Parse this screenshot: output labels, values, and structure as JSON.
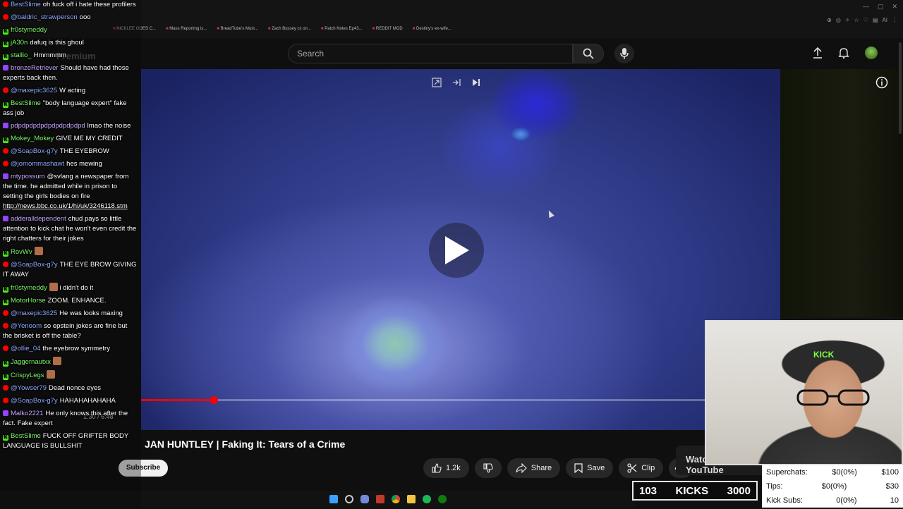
{
  "browser": {
    "bookmarks": [
      "NICKLEE GOES C...",
      "Mass Reporting is...",
      "BreadTube's Most...",
      "Zach Bussey cx on...",
      "Patch Notes Ep43...",
      "REDDIT MOD",
      "Destiny's ex-wife..."
    ]
  },
  "header": {
    "logo_text": "Premium",
    "search_placeholder": "Search"
  },
  "video": {
    "title": "JAN HUNTLEY | Faking It: Tears of a Crime",
    "time": "1:30 / 6:48",
    "progress_fraction": 0.13
  },
  "channel": {
    "subscribe_label": "Subscribe"
  },
  "actions": {
    "like_count": "1.2k",
    "share_label": "Share",
    "save_label": "Save",
    "clip_label": "Clip"
  },
  "watch_on": "Watch on YouTube",
  "chat": {
    "messages": [
      {
        "platform": "yt",
        "user": "BestSlime",
        "text": "oh fuck off i hate these profilers",
        "color": "u-blue"
      },
      {
        "platform": "yt",
        "user": "@baldric_strawperson",
        "text": "ooo",
        "color": "u-blue"
      },
      {
        "platform": "kick",
        "user": "fr0stymeddy",
        "text": "",
        "color": "u-green"
      },
      {
        "platform": "kick",
        "user": "jA30n",
        "text": "dafuq is this ghoul",
        "color": "u-green"
      },
      {
        "platform": "kick",
        "user": "stallio_",
        "text": "Hmmmmm",
        "color": "u-green"
      },
      {
        "platform": "twitch",
        "user": "bronzeRetriever",
        "text": "Should have had those experts back then.",
        "color": "u-purple"
      },
      {
        "platform": "yt",
        "user": "@maxepic3625",
        "text": "W acting",
        "color": "u-blue"
      },
      {
        "platform": "kick",
        "user": "BestSlime",
        "text": "\"body language expert\" fake ass job",
        "color": "u-green"
      },
      {
        "platform": "twitch",
        "user": "pdpdpdpdpdpdpdpdpdpd",
        "text": "lmao the noise",
        "color": "u-purple"
      },
      {
        "platform": "kick",
        "user": "Mokey_Mokey",
        "text": "GIVE ME MY CREDIT",
        "color": "u-green"
      },
      {
        "platform": "yt",
        "user": "@SoapBox-g7y",
        "text": "THE EYEBROW",
        "color": "u-blue"
      },
      {
        "platform": "yt",
        "user": "@jomommashawt",
        "text": "hes mewing",
        "color": "u-blue"
      },
      {
        "platform": "twitch",
        "user": "mtypossum",
        "text": "@svlang a newspaper from the time. he admitted while in prison to setting the girls bodies on fire",
        "link": "http://news.bbc.co.uk/1/hi/uk/3246118.stm",
        "color": "u-purple"
      },
      {
        "platform": "twitch",
        "user": "adderalldependent",
        "text": "chud pays so little attention to kick chat he won't even credit the right chatters for their jokes",
        "color": "u-purple"
      },
      {
        "platform": "kick",
        "user": "RovWv",
        "text": "",
        "emote": true,
        "color": "u-green"
      },
      {
        "platform": "yt",
        "user": "@SoapBox-g7y",
        "text": "THE EYE BROW GIVING IT AWAY",
        "color": "u-blue"
      },
      {
        "platform": "kick",
        "user": "fr0stymeddy",
        "text": "i didn't do it",
        "emote": true,
        "color": "u-green"
      },
      {
        "platform": "kick",
        "user": "MotorHorse",
        "text": "ZOOM. ENHANCE.",
        "color": "u-green"
      },
      {
        "platform": "yt",
        "user": "@maxepic3625",
        "text": "He was looks maxing",
        "color": "u-blue"
      },
      {
        "platform": "yt",
        "user": "@Yenoom",
        "text": "so epstein jokes are fine but the brisket is off the table?",
        "color": "u-blue"
      },
      {
        "platform": "yt",
        "user": "@ollie_04",
        "text": "the eyebrow symmetry",
        "color": "u-blue"
      },
      {
        "platform": "kick",
        "user": "Jaggernautxx",
        "text": "",
        "emote": true,
        "color": "u-green"
      },
      {
        "platform": "kick",
        "user": "CrispyLegs",
        "text": "",
        "emote": true,
        "color": "u-green"
      },
      {
        "platform": "yt",
        "user": "@Yowser79",
        "text": "Dead nonce eyes",
        "color": "u-blue"
      },
      {
        "platform": "yt",
        "user": "@SoapBox-g7y",
        "text": "HAHAHAHAHAHA",
        "color": "u-blue"
      },
      {
        "platform": "twitch",
        "user": "Malko2221",
        "text": "He only knows this after the fact. Fake expert",
        "color": "u-purple"
      },
      {
        "platform": "kick",
        "user": "BestSlime",
        "text": "FUCK OFF GRIFTER BODY LANGUAGE IS BULLSHIT",
        "color": "u-green"
      }
    ]
  },
  "webcam": {
    "cap_text": "KICK"
  },
  "stats": {
    "rows": [
      {
        "label": "Superchats:",
        "value": "$0(0%)",
        "goal": "$100"
      },
      {
        "label": "Tips:",
        "value": "$0(0%)",
        "goal": "$30"
      },
      {
        "label": "Kick Subs:",
        "value": "0(0%)",
        "goal": "10"
      }
    ]
  },
  "kicks_bar": {
    "count": "103",
    "label": "KICKS",
    "goal": "3000"
  },
  "colors": {
    "accent": "#ff0000",
    "kick_green": "#53fc18",
    "youtube_bg": "#0f0f0f"
  }
}
